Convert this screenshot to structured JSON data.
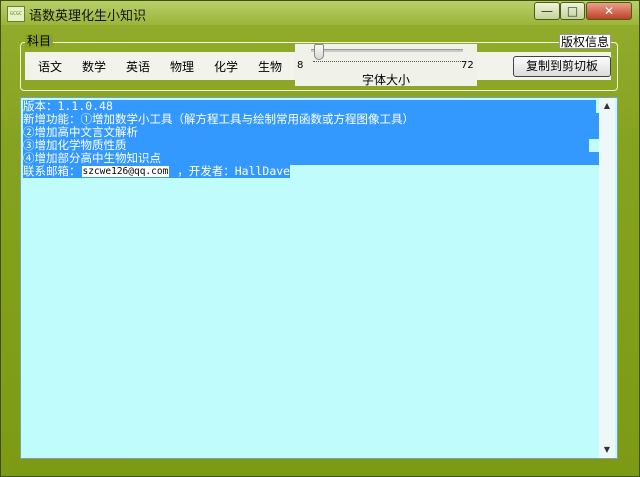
{
  "window": {
    "title": "语数英理化生小知识",
    "app_icon_text": "GCGC",
    "minimize": "—",
    "maximize": "□",
    "close": "✕"
  },
  "subject_group": {
    "label": "科目",
    "items": [
      "语文",
      "数学",
      "英语",
      "物理",
      "化学",
      "生物"
    ]
  },
  "copyright_label": "版权信息",
  "font_size": {
    "min": "8",
    "max": "72",
    "label": "字体大小",
    "value_fraction": 0.04
  },
  "copy_button": "复制到剪切板",
  "editor": {
    "lines": [
      "版本：1.1.0.48",
      "新增功能：①增加数学小工具（解方程工具与绘制常用函数或方程图像工具）",
      "②增加高中文言文解析",
      "③增加化学物质性质",
      "④增加部分高中生物知识点"
    ],
    "contact_prefix": "联系邮箱：",
    "email": "szcwe126@qq.com",
    "contact_suffix": " ，开发者：HallDave"
  },
  "colors": {
    "frame": "#8aa524",
    "editor_bg": "#c0fcfc",
    "selection": "#3399ff"
  }
}
